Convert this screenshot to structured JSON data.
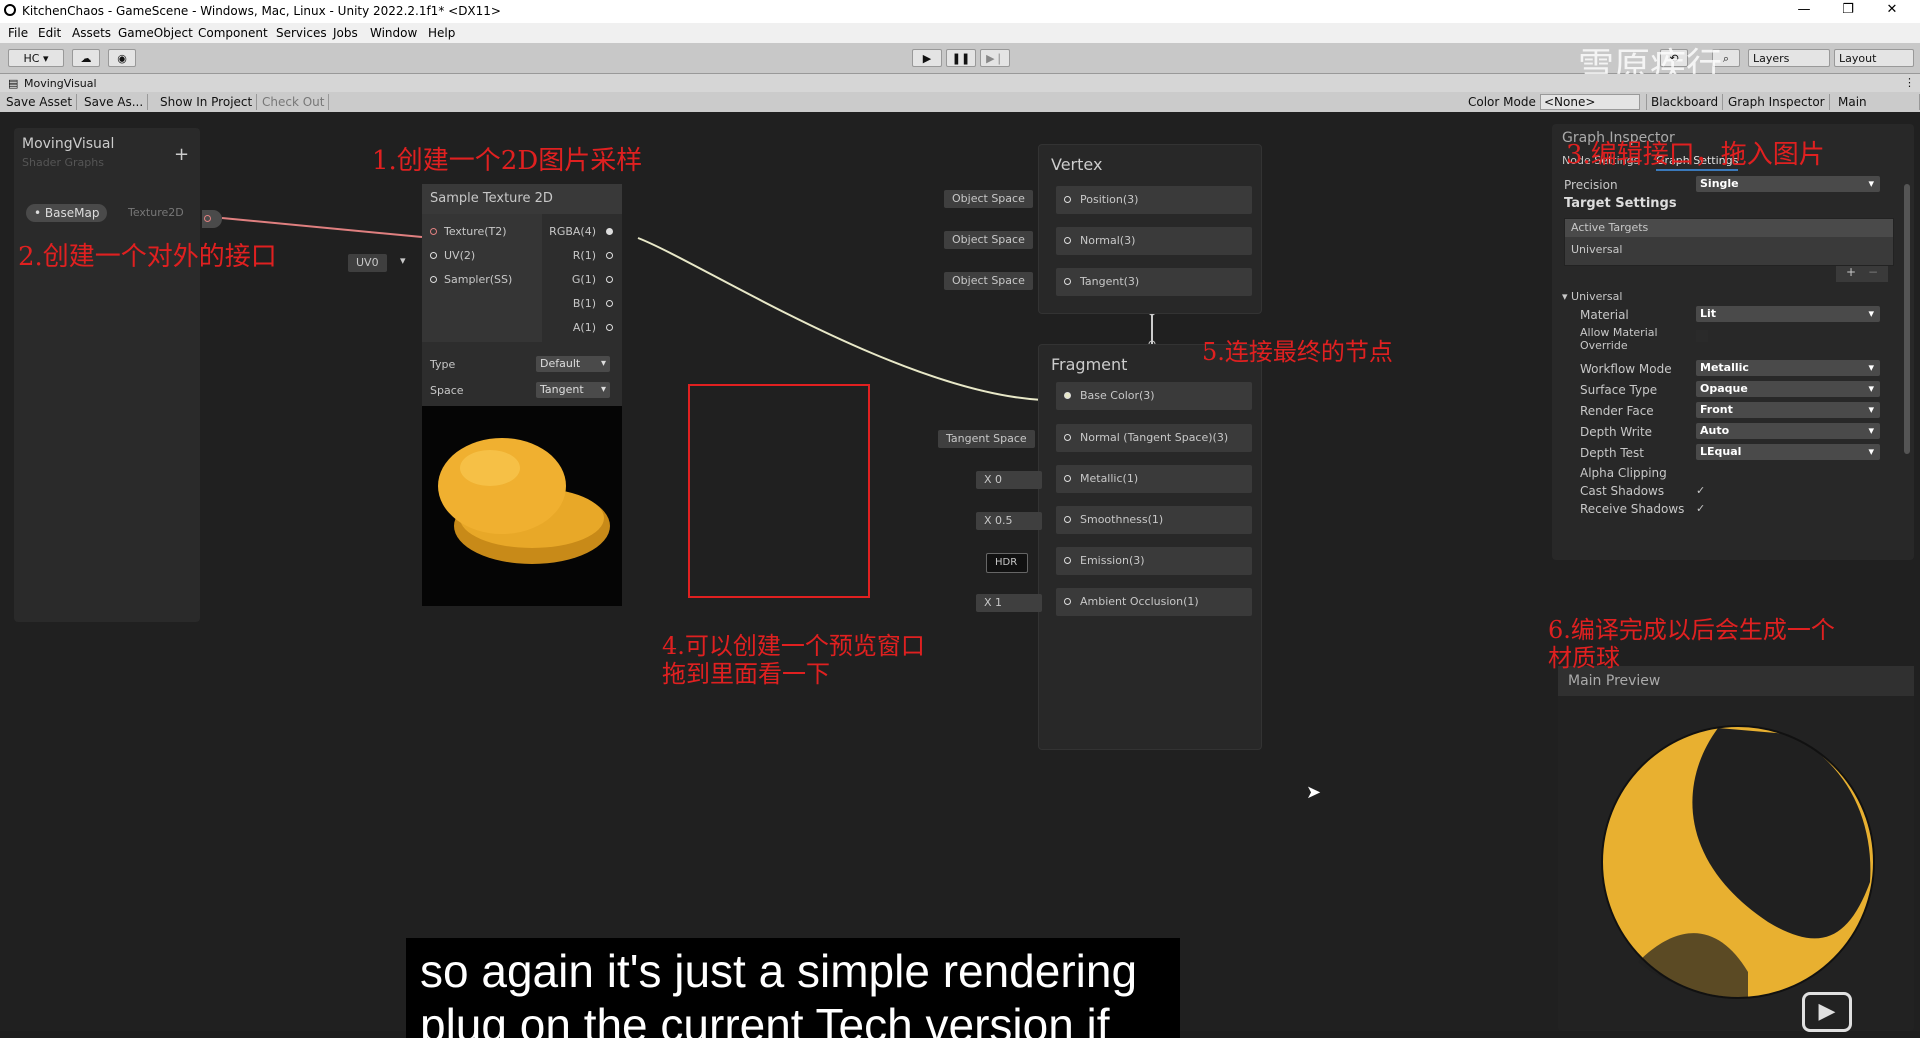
{
  "window": {
    "title": "KitchenChaos - GameScene - Windows, Mac, Linux - Unity 2022.2.1f1* <DX11>",
    "minimize": "—",
    "restore": "❐",
    "close": "✕"
  },
  "menu": [
    "File",
    "Edit",
    "Assets",
    "GameObject",
    "Component",
    "Services",
    "Jobs",
    "Window",
    "Help"
  ],
  "toolbar": {
    "account": "HC ▾",
    "layers": "Layers",
    "layout": "Layout"
  },
  "tab": {
    "title": "MovingVisual"
  },
  "actions": {
    "save_asset": "Save Asset",
    "save_as": "Save As...",
    "show_in_project": "Show In Project",
    "check_out": "Check Out",
    "color_mode_label": "Color Mode",
    "color_mode_value": "<None>",
    "blackboard": "Blackboard",
    "graph_inspector": "Graph Inspector",
    "main_preview": "Main Preview"
  },
  "blackboard": {
    "title": "MovingVisual",
    "subtitle": "Shader Graphs",
    "add": "+",
    "property_name": "BaseMap",
    "property_type": "Texture2D"
  },
  "sample_node": {
    "title": "Sample Texture 2D",
    "inputs": [
      "Texture(T2)",
      "UV(2)",
      "Sampler(SS)"
    ],
    "outputs": [
      "RGBA(4)",
      "R(1)",
      "G(1)",
      "B(1)",
      "A(1)"
    ],
    "uv_value": "UV0",
    "type_label": "Type",
    "type_value": "Default",
    "space_label": "Space",
    "space_value": "Tangent"
  },
  "vertex": {
    "title": "Vertex",
    "slots": [
      {
        "input": "Object Space",
        "label": "Position(3)"
      },
      {
        "input": "Object Space",
        "label": "Normal(3)"
      },
      {
        "input": "Object Space",
        "label": "Tangent(3)"
      }
    ]
  },
  "fragment": {
    "title": "Fragment",
    "slots": [
      {
        "input": "",
        "label": "Base Color(3)"
      },
      {
        "input": "Tangent Space",
        "label": "Normal (Tangent Space)(3)"
      },
      {
        "input": "X  0",
        "label": "Metallic(1)"
      },
      {
        "input": "X  0.5",
        "label": "Smoothness(1)"
      },
      {
        "input": "HDR",
        "label": "Emission(3)"
      },
      {
        "input": "X  1",
        "label": "Ambient Occlusion(1)"
      }
    ]
  },
  "inspector": {
    "title": "Graph Inspector",
    "tab_node": "Node Settings",
    "tab_graph": "Graph Settings",
    "precision_label": "Precision",
    "precision_value": "Single",
    "target_settings": "Target Settings",
    "active_targets": "Active Targets",
    "target_universal": "Universal",
    "section_universal": "Universal",
    "rows": [
      {
        "label": "Material",
        "value": "Lit"
      },
      {
        "label": "Allow Material Override",
        "value": ""
      },
      {
        "label": "Workflow Mode",
        "value": "Metallic"
      },
      {
        "label": "Surface Type",
        "value": "Opaque"
      },
      {
        "label": "Render Face",
        "value": "Front"
      },
      {
        "label": "Depth Write",
        "value": "Auto"
      },
      {
        "label": "Depth Test",
        "value": "LEqual"
      },
      {
        "label": "Alpha Clipping",
        "value": ""
      },
      {
        "label": "Cast Shadows",
        "value": "✓"
      },
      {
        "label": "Receive Shadows",
        "value": "✓"
      }
    ]
  },
  "main_preview": {
    "title": "Main Preview"
  },
  "annotations": {
    "a1": "1.创建一个2D图片采样",
    "a2": "2.创建一个对外的接口",
    "a3": "3.编辑接口，拖入图片",
    "a4_line1": "4.可以创建一个预览窗口",
    "a4_line2": "拖到里面看一下",
    "a5": "5.连接最终的节点",
    "a6_line1": "6.编译完成以后会生成一个",
    "a6_line2": "材质球"
  },
  "watermark": "雪原疾行",
  "subtitle": {
    "line1": "so again it's just a simple rendering",
    "line2": "plug on the current Tech version if"
  },
  "colors": {
    "annotation": "#e02020",
    "wire": "#e8e8c8",
    "texture_wire": "#e08080",
    "preview_border": "#e02020"
  }
}
